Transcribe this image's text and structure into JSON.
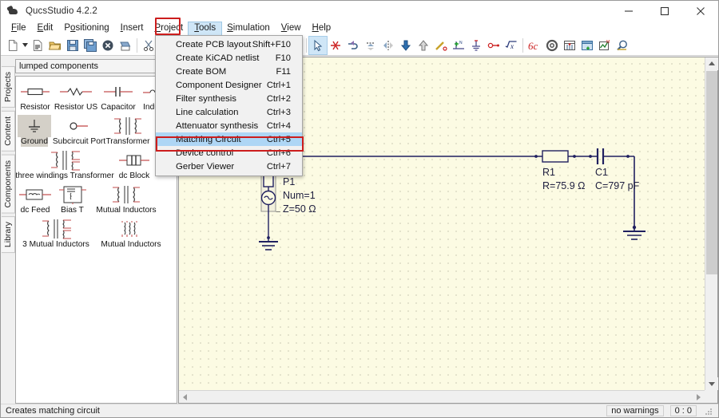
{
  "window": {
    "title": "QucsStudio 4.2.2",
    "icon": "app-logo-icon",
    "controls": {
      "minimize": "minimize-icon",
      "maximize": "maximize-icon",
      "close": "close-icon"
    }
  },
  "menubar": {
    "items": [
      {
        "label": "File",
        "mnemonic": "F"
      },
      {
        "label": "Edit",
        "mnemonic": "E"
      },
      {
        "label": "Positioning",
        "mnemonic": "o"
      },
      {
        "label": "Insert",
        "mnemonic": "I"
      },
      {
        "label": "Project",
        "mnemonic": "P"
      },
      {
        "label": "Tools",
        "mnemonic": "T",
        "active": true
      },
      {
        "label": "Simulation",
        "mnemonic": "S"
      },
      {
        "label": "View",
        "mnemonic": "V"
      },
      {
        "label": "Help",
        "mnemonic": "H"
      }
    ],
    "highlight_color": "#cc1d1d"
  },
  "dropdown": {
    "owner": "Tools",
    "highlight_color": "#cc1d1d",
    "selected_bg": "#aed6f5",
    "items": [
      {
        "label": "Create PCB layout",
        "shortcut": "Shift+F10"
      },
      {
        "label": "Create KiCAD netlist",
        "shortcut": "F10"
      },
      {
        "label": "Create BOM",
        "shortcut": "F11"
      },
      {
        "label": "Component Designer",
        "shortcut": "Ctrl+1"
      },
      {
        "label": "Filter synthesis",
        "shortcut": "Ctrl+2"
      },
      {
        "label": "Line calculation",
        "shortcut": "Ctrl+3"
      },
      {
        "label": "Attenuator synthesis",
        "shortcut": "Ctrl+4"
      },
      {
        "label": "Matching Circuit",
        "shortcut": "Ctrl+5",
        "highlighted": true
      },
      {
        "label": "Device control",
        "shortcut": "Ctrl+6"
      },
      {
        "label": "Gerber Viewer",
        "shortcut": "Ctrl+7"
      }
    ]
  },
  "toolbar": {
    "groups": [
      [
        "new-document-icon",
        "dropdown-caret-icon",
        "new-text-document-icon",
        "open-folder-icon",
        "save-icon",
        "save-all-icon",
        "close-document-icon",
        "print-icon"
      ],
      [
        "cut-icon",
        "copy-icon",
        "paste-icon",
        "delete-icon",
        "undo-icon",
        "redo-icon"
      ],
      [
        "zoom-in-icon",
        "zoom-fit-icon",
        "zoom-out-icon"
      ],
      [
        "select-arrow-icon",
        "delete-wire-icon",
        "rotate-icon",
        "mirror-x-icon",
        "mirror-y-icon",
        "move-down-icon",
        "move-up-icon",
        "wire-icon",
        "wire-label-icon",
        "ground-icon",
        "port-icon",
        "equation-icon"
      ],
      [
        "marker-icon",
        "settings-icon",
        "diagram-icon",
        "new-window-icon",
        "simulate-icon",
        "magnifier-icon"
      ]
    ],
    "selected": "select-arrow-icon"
  },
  "sidebar": {
    "vertical_tabs": [
      "Projects",
      "Content",
      "Components",
      "Library"
    ],
    "active_tab": "Components",
    "category": "lumped components",
    "components": [
      {
        "label": "Resistor",
        "icon": "resistor-icon"
      },
      {
        "label": "Resistor US",
        "icon": "resistor-us-icon"
      },
      {
        "label": "Capacitor",
        "icon": "capacitor-icon"
      },
      {
        "label": "Inductor",
        "icon": "inductor-icon"
      },
      {
        "label": "Ground",
        "icon": "ground-icon",
        "selected": true
      },
      {
        "label": "Subcircuit Port",
        "icon": "subcircuit-port-icon"
      },
      {
        "label": "Transformer",
        "icon": "transformer-icon"
      },
      {
        "label": "three windings Transformer",
        "icon": "three-winding-transformer-icon"
      },
      {
        "label": "dc Block",
        "icon": "dc-block-icon"
      },
      {
        "label": "dc Feed",
        "icon": "dc-feed-icon"
      },
      {
        "label": "Bias T",
        "icon": "bias-t-icon"
      },
      {
        "label": "Mutual Inductors",
        "icon": "mutual-inductors-icon"
      },
      {
        "label": "3 Mutual Inductors",
        "icon": "three-mutual-inductors-icon"
      },
      {
        "label": "Mutual Inductors",
        "icon": "mutual-inductors-coil-icon"
      }
    ]
  },
  "schematic": {
    "background": "#fcfbe3",
    "wire_color": "#202060",
    "port": {
      "name": "P1",
      "num_line": "Num=1",
      "z_line": "Z=50 Ω",
      "plus": "+",
      "minus": "−"
    },
    "resistor": {
      "name": "R1",
      "value": "R=75.9 Ω"
    },
    "capacitor": {
      "name": "C1",
      "value": "C=797 pF"
    }
  },
  "statusbar": {
    "message": "Creates matching circuit",
    "warnings": "no warnings",
    "position": "0 : 0"
  }
}
